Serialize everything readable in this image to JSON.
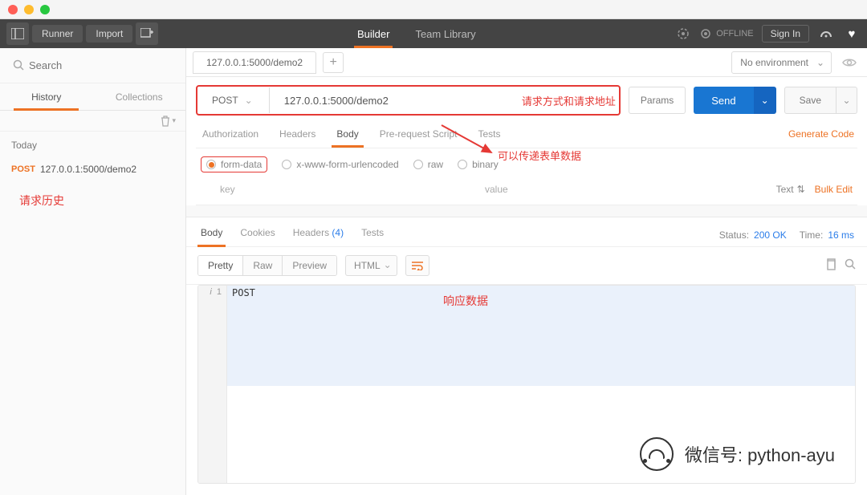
{
  "toolbar": {
    "runner": "Runner",
    "import": "Import",
    "builder": "Builder",
    "team_library": "Team Library",
    "offline": "OFFLINE",
    "signin": "Sign In"
  },
  "sidebar": {
    "search_placeholder": "Search",
    "tabs": {
      "history": "History",
      "collections": "Collections"
    },
    "today": "Today",
    "item": {
      "method": "POST",
      "url": "127.0.0.1:5000/demo2"
    },
    "anno": "请求历史"
  },
  "tabs": {
    "active": "127.0.0.1:5000/demo2"
  },
  "env": {
    "label": "No environment"
  },
  "request": {
    "method": "POST",
    "url": "127.0.0.1:5000/demo2",
    "anno": "请求方式和请求地址",
    "params": "Params",
    "send": "Send",
    "save": "Save",
    "tabs": {
      "authorization": "Authorization",
      "headers": "Headers",
      "body": "Body",
      "prerequest": "Pre-request Script",
      "tests": "Tests"
    },
    "gen_code": "Generate Code",
    "body_types": {
      "formdata": "form-data",
      "urlencoded": "x-www-form-urlencoded",
      "raw": "raw",
      "binary": "binary"
    },
    "kv": {
      "key": "key",
      "value": "value",
      "text": "Text",
      "bulk": "Bulk Edit"
    },
    "anno2": "可以传递表单数据"
  },
  "response": {
    "tabs": {
      "body": "Body",
      "cookies": "Cookies",
      "headers": "Headers",
      "headers_count": "(4)",
      "tests": "Tests"
    },
    "status_label": "Status:",
    "status_value": "200 OK",
    "time_label": "Time:",
    "time_value": "16 ms",
    "view": {
      "pretty": "Pretty",
      "raw": "Raw",
      "preview": "Preview",
      "format": "HTML"
    },
    "line_num": "1",
    "line_indicator": "i",
    "code": "POST",
    "anno": "响应数据"
  },
  "watermark": {
    "label": "微信号: python-ayu"
  }
}
